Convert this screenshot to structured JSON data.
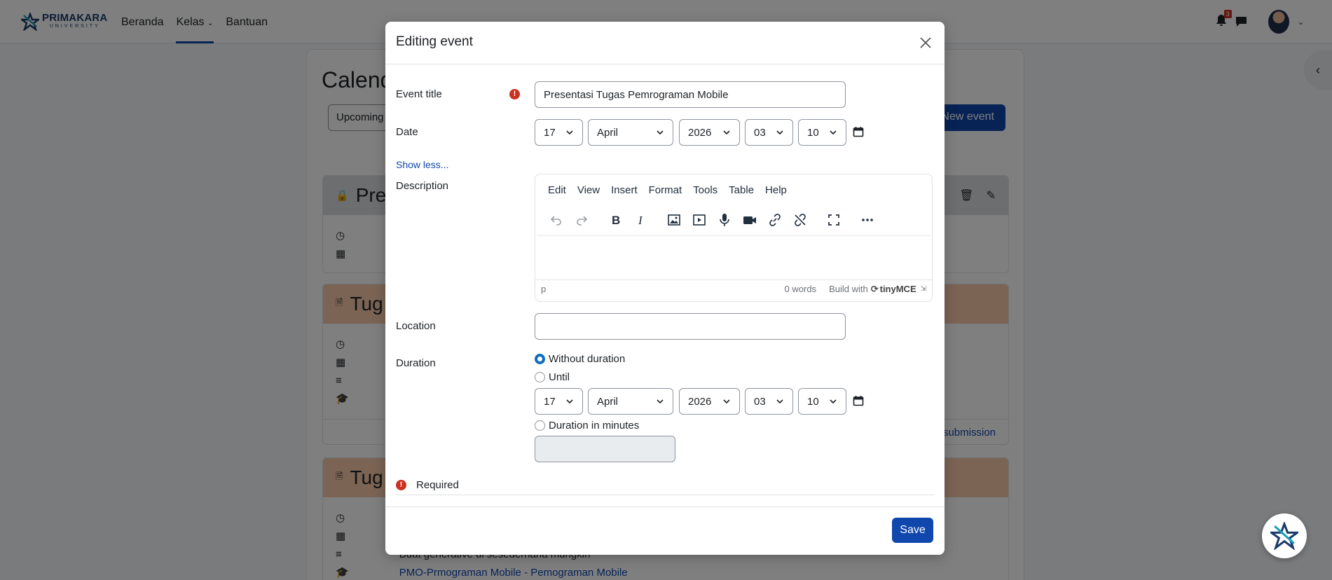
{
  "nav": {
    "brand_name": "PRIMAKARA",
    "brand_sub": "UNIVERSITY",
    "links": [
      {
        "label": "Beranda"
      },
      {
        "label": "Kelas"
      },
      {
        "label": "Bantuan"
      }
    ],
    "notification_count": "3"
  },
  "page": {
    "title": "Calend",
    "upcoming_label": "Upcoming",
    "new_event_label": "New event"
  },
  "events": [
    {
      "title": "Pres"
    },
    {
      "title": "Tug",
      "footer_link": "submission"
    },
    {
      "title": "Tug",
      "description": "Buat generative ui sesederhana mungkin",
      "course_link": "PMO-Prmograman Mobile - Pemograman Mobile"
    }
  ],
  "modal": {
    "title": "Editing event",
    "event_title_label": "Event title",
    "event_title_value": "Presentasi Tugas Pemrograman Mobile",
    "date_label": "Date",
    "date": {
      "day": "17",
      "month": "April",
      "year": "2026",
      "hour": "03",
      "minute": "10"
    },
    "show_less": "Show less...",
    "description_label": "Description",
    "editor": {
      "menu": [
        "Edit",
        "View",
        "Insert",
        "Format",
        "Tools",
        "Table",
        "Help"
      ],
      "status_path": "p",
      "word_count": "0 words",
      "build_with": "Build with",
      "brand": "tinyMCE"
    },
    "location_label": "Location",
    "location_value": "",
    "duration_label": "Duration",
    "duration_options": {
      "without": "Without duration",
      "until": "Until",
      "minutes": "Duration in minutes"
    },
    "until_date": {
      "day": "17",
      "month": "April",
      "year": "2026",
      "hour": "03",
      "minute": "10"
    },
    "required_note": "Required",
    "save_label": "Save"
  },
  "colors": {
    "primary": "#0f47ad",
    "danger": "#ca3120",
    "event_gray": "#d8dde1",
    "event_peach": "#f7c9a9"
  }
}
